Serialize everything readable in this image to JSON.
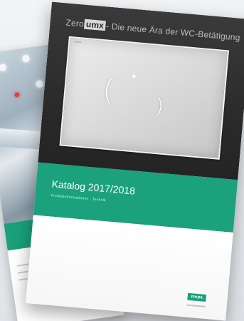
{
  "front_catalog": {
    "headline_brand_prefix": "Zero",
    "headline_brand_box": "umx",
    "headline_rest": "- Die neue Ära der WC-Betätigung",
    "title": "Katalog 2017/2018",
    "subtitle": "Produktinformationen · Technik",
    "logo_text": "mepa"
  },
  "colors": {
    "brand_green": "#1ba17c",
    "cover_dark": "#2b2b2b",
    "background": "#eceff1"
  }
}
